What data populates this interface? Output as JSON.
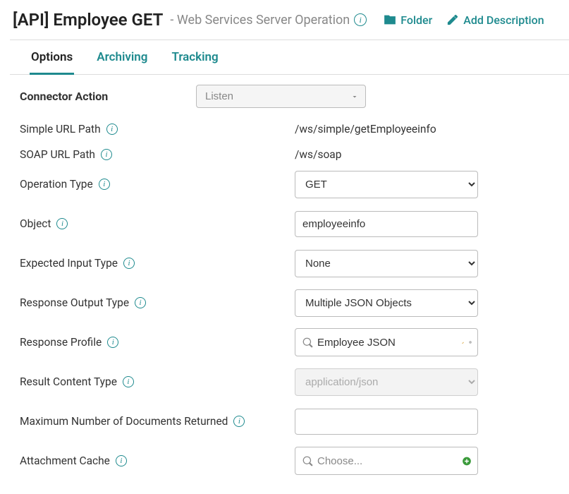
{
  "header": {
    "title": "[API] Employee GET",
    "subtitle": "- Web Services Server Operation",
    "folder_label": "Folder",
    "add_description_label": "Add Description"
  },
  "tabs": {
    "options": "Options",
    "archiving": "Archiving",
    "tracking": "Tracking"
  },
  "form": {
    "connector_action": {
      "label": "Connector Action",
      "value": "Listen"
    },
    "simple_url_path": {
      "label": "Simple URL Path",
      "value": "/ws/simple/getEmployeeinfo"
    },
    "soap_url_path": {
      "label": "SOAP URL Path",
      "value": "/ws/soap"
    },
    "operation_type": {
      "label": "Operation Type",
      "value": "GET"
    },
    "object": {
      "label": "Object",
      "value": "employeeinfo"
    },
    "expected_input_type": {
      "label": "Expected Input Type",
      "value": "None"
    },
    "response_output_type": {
      "label": "Response Output Type",
      "value": "Multiple JSON Objects"
    },
    "response_profile": {
      "label": "Response Profile",
      "value": "Employee JSON"
    },
    "result_content_type": {
      "label": "Result Content Type",
      "value": "application/json"
    },
    "max_docs": {
      "label": "Maximum Number of Documents Returned",
      "value": ""
    },
    "attachment_cache": {
      "label": "Attachment Cache",
      "placeholder": "Choose..."
    }
  }
}
